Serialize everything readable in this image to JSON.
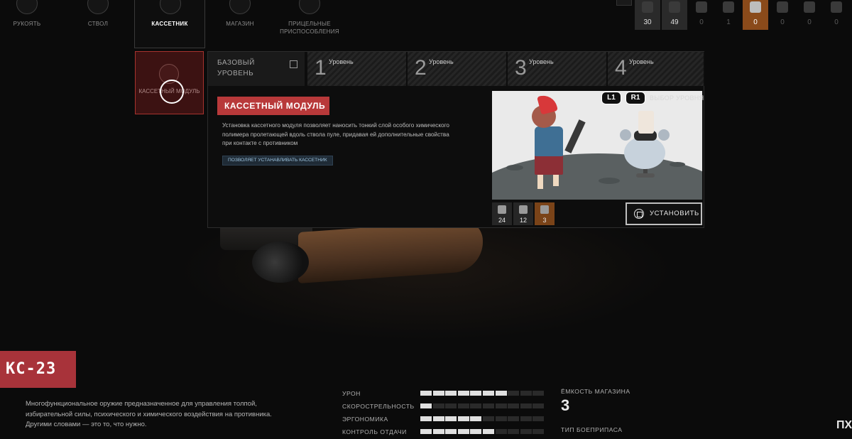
{
  "slots": [
    {
      "label": "РУКОЯТЬ"
    },
    {
      "label": "СТВОЛ"
    },
    {
      "label": "КАССЕТНИК"
    },
    {
      "label": "МАГАЗИН"
    },
    {
      "label": "ПРИЦЕЛЬНЫЕ ПРИСПОСОБЛЕНИЯ"
    }
  ],
  "resources": [
    "30",
    "49",
    "0",
    "1",
    "0",
    "0",
    "0",
    "0"
  ],
  "module_card": {
    "label": "КАССЕТНЫЙ МОДУЛЬ"
  },
  "tabs": {
    "base": "БАЗОВЫЙ УРОВЕНЬ",
    "levels": [
      {
        "num": "1",
        "word": "Уровень"
      },
      {
        "num": "2",
        "word": "Уровень"
      },
      {
        "num": "3",
        "word": "Уровень"
      },
      {
        "num": "4",
        "word": "Уровень"
      }
    ]
  },
  "module": {
    "title": "КАССЕТНЫЙ МОДУЛЬ",
    "description": "Установка кассетного модуля позволяет наносить тонкий слой особого химического полимера пролетающей вдоль ствола пуле, придавая ей дополнительные свойства при контакте с противником",
    "perk": "ПОЗВОЛЯЕТ УСТАНАВЛИВАТЬ КАССЕТНИК"
  },
  "level_select": {
    "l1": "L1",
    "r1": "R1",
    "label": "ВЫБОР УРОВНЯ"
  },
  "costs": [
    "24",
    "12",
    "3"
  ],
  "install_label": "УСТАНОВИТЬ",
  "weapon": {
    "name": "КС-23",
    "description": "Многофункциональное оружие предназначенное для управления толпой, избирательной силы, психического и химического воздействия на противника. Другими словами — это то, что нужно."
  },
  "stats": [
    {
      "label": "УРОН",
      "value": 7,
      "max": 10
    },
    {
      "label": "СКОРОСТРЕЛЬНОСТЬ",
      "value": 1,
      "max": 10
    },
    {
      "label": "ЭРГОНОМИКА",
      "value": 5,
      "max": 10
    },
    {
      "label": "КОНТРОЛЬ ОТДАЧИ",
      "value": 6,
      "max": 10
    }
  ],
  "capacity": {
    "label": "ЁМКОСТЬ МАГАЗИНА",
    "value": "3"
  },
  "ammo_type": {
    "label": "ТИП БОЕПРИПАСА"
  },
  "corner_text": "ПХІ",
  "colors": {
    "accent_red": "#b8393a",
    "resource_orange": "#8a4a1a",
    "perk_blue": "#9ec5e0"
  }
}
